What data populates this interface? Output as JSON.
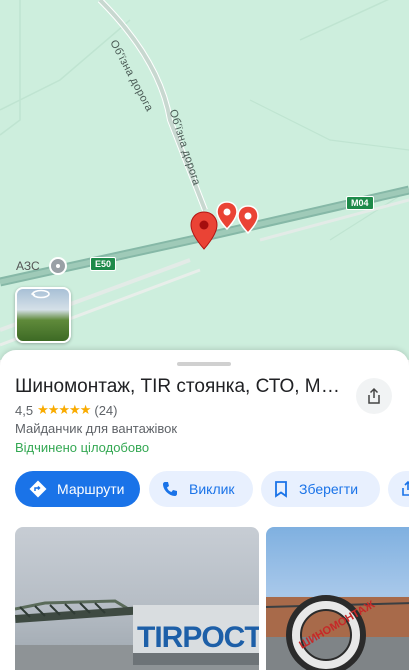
{
  "map": {
    "road_labels": [
      "Об'їзна дорога",
      "Об'їзна дорога"
    ],
    "shields": [
      "M04",
      "E50"
    ],
    "poi_label": "АЗС",
    "colors": {
      "land": "#cdeedd",
      "road": "#86b8a7",
      "pin": "#ea4335"
    }
  },
  "place": {
    "title": "Шиномонтаж, TIR стоянка, СТО, Мо...",
    "rating": "4,5",
    "stars": "★★★★★",
    "review_count": "(24)",
    "category": "Майданчик для вантажівок",
    "status": "Відчинено цілодобово"
  },
  "actions": {
    "directions": "Маршрути",
    "call": "Виклик",
    "save": "Зберегти"
  },
  "icons": [
    "share-icon",
    "directions-icon",
    "phone-icon",
    "bookmark-icon",
    "more-share-icon",
    "rotate-360-icon"
  ],
  "photos": {
    "photo1_sign": "TIRPOCT",
    "photo2_sign": "ШИНОМОНТАЖ"
  }
}
